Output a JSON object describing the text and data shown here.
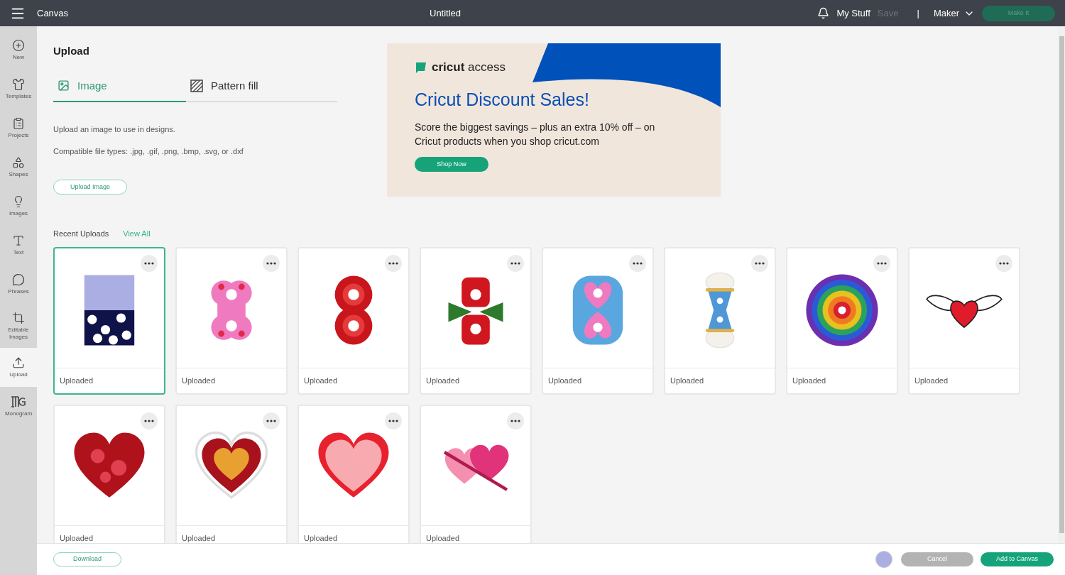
{
  "header": {
    "menu_label": "Canvas",
    "title": "Untitled",
    "my_stuff": "My Stuff",
    "save": {
      "label": "Save",
      "disabled": true
    },
    "separator": "|",
    "machine": "Maker",
    "make_it": {
      "label": "Make It",
      "disabled": true
    }
  },
  "sidebar": {
    "items": [
      {
        "label": "New",
        "selected": false
      },
      {
        "label": "Templates",
        "selected": false
      },
      {
        "label": "Projects",
        "selected": false
      },
      {
        "label": "Shapes",
        "selected": false
      },
      {
        "label": "Images",
        "selected": false
      },
      {
        "label": "Text",
        "selected": false
      },
      {
        "label": "Phrases",
        "selected": false
      },
      {
        "label": "Editable Images",
        "selected": false
      },
      {
        "label": "Upload",
        "selected": true
      },
      {
        "label": "Monogram",
        "selected": false
      }
    ]
  },
  "panel": {
    "title": "Upload",
    "tabs": [
      {
        "label": "Image",
        "selected": true
      },
      {
        "label": "Pattern fill",
        "selected": false
      }
    ],
    "description": "Upload an image to use in designs.",
    "file_types": "Compatible file types: .jpg, .gif, .png, .bmp, .svg, or .dxf",
    "upload_button": "Upload Image"
  },
  "banner": {
    "brand": "**cricut** access",
    "title": "Cricut Discount Sales!",
    "body": "Score the biggest savings – plus an extra 10% off – on Cricut products when you shop cricut.com",
    "button": "Shop Now"
  },
  "recent": {
    "heading": "Recent Uploads",
    "view_all": "View All",
    "uploads": [
      {
        "label": "Uploaded",
        "selected": true
      },
      {
        "label": "Uploaded",
        "selected": false
      },
      {
        "label": "Uploaded",
        "selected": false
      },
      {
        "label": "Uploaded",
        "selected": false
      },
      {
        "label": "Uploaded",
        "selected": false
      },
      {
        "label": "Uploaded",
        "selected": false
      },
      {
        "label": "Uploaded",
        "selected": false
      },
      {
        "label": "Uploaded",
        "selected": false
      },
      {
        "label": "Uploaded",
        "selected": false
      },
      {
        "label": "Uploaded",
        "selected": false
      },
      {
        "label": "Uploaded",
        "selected": false
      },
      {
        "label": "Uploaded",
        "selected": false
      }
    ]
  },
  "footer": {
    "download": "Download",
    "cancel": "Cancel",
    "add": "Add to Canvas"
  }
}
